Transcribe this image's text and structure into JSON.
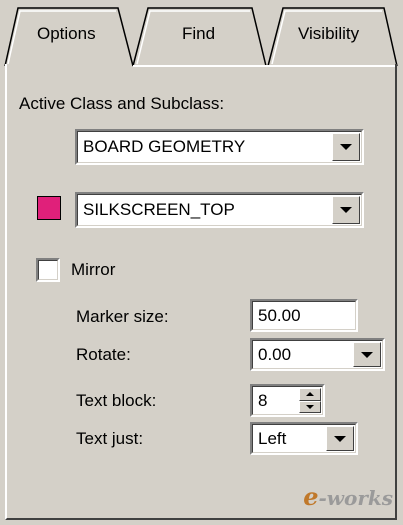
{
  "tabs": [
    {
      "label": "Options",
      "active": true
    },
    {
      "label": "Find",
      "active": false
    },
    {
      "label": "Visibility",
      "active": false
    }
  ],
  "active_class": {
    "heading": "Active Class and Subclass:",
    "class_value": "BOARD GEOMETRY",
    "subclass_value": "SILKSCREEN_TOP",
    "swatch_color": "#e0207a"
  },
  "mirror": {
    "label": "Mirror",
    "checked": false
  },
  "fields": {
    "marker_size": {
      "label": "Marker size:",
      "value": "50.00"
    },
    "rotate": {
      "label": "Rotate:",
      "value": "0.00"
    },
    "text_block": {
      "label": "Text block:",
      "value": "8"
    },
    "text_just": {
      "label": "Text just:",
      "value": "Left"
    }
  },
  "watermark": {
    "e": "e",
    "rest": "-works"
  }
}
